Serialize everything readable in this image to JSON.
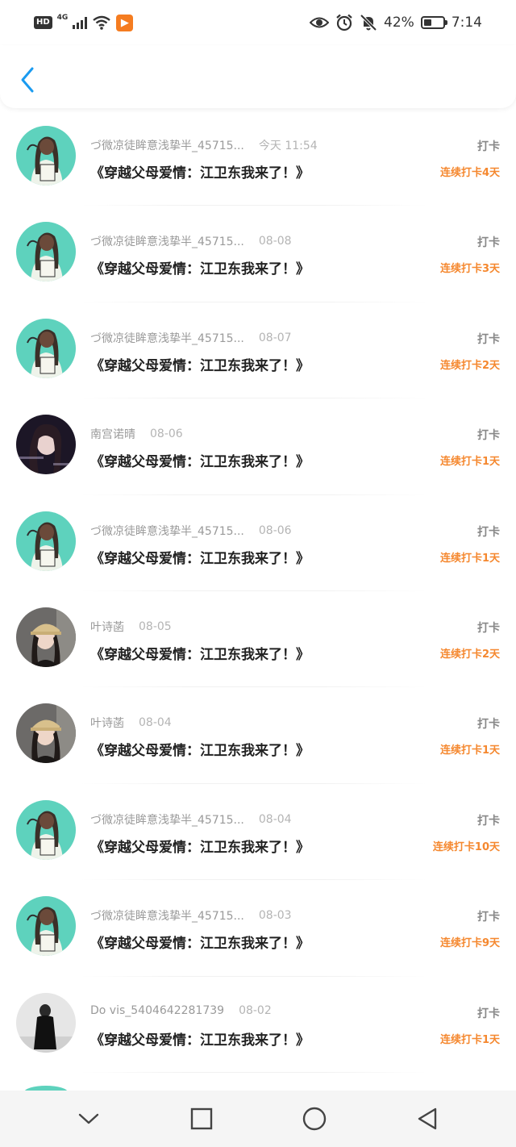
{
  "status_bar": {
    "hd": "HD",
    "network": "4G",
    "battery_pct": "42%",
    "battery_level": 0.42,
    "time": "7:14",
    "icons": [
      "eye-icon",
      "alarm-icon",
      "mute-bell-icon"
    ]
  },
  "header": {
    "back_icon": "chevron-left-icon"
  },
  "colors": {
    "accent": "#f5882f",
    "back": "#1a9bf0",
    "avatar_teal": "#5ed2bd"
  },
  "records": [
    {
      "avatar": "anime",
      "name": "づ微凉徒眸意浅挚半_45715...",
      "date": "今天 11:54",
      "title": "《穿越父母爱情：江卫东我来了！》",
      "tag": "打卡",
      "streak": "连续打卡4天"
    },
    {
      "avatar": "anime",
      "name": "づ微凉徒眸意浅挚半_45715...",
      "date": "08-08",
      "title": "《穿越父母爱情：江卫东我来了！》",
      "tag": "打卡",
      "streak": "连续打卡3天"
    },
    {
      "avatar": "anime",
      "name": "づ微凉徒眸意浅挚半_45715...",
      "date": "08-07",
      "title": "《穿越父母爱情：江卫东我来了！》",
      "tag": "打卡",
      "streak": "连续打卡2天"
    },
    {
      "avatar": "photo-dark",
      "name": "南宫诺晴",
      "date": "08-06",
      "title": "《穿越父母爱情：江卫东我来了！》",
      "tag": "打卡",
      "streak": "连续打卡1天"
    },
    {
      "avatar": "anime",
      "name": "づ微凉徒眸意浅挚半_45715...",
      "date": "08-06",
      "title": "《穿越父母爱情：江卫东我来了！》",
      "tag": "打卡",
      "streak": "连续打卡1天"
    },
    {
      "avatar": "photo-cap",
      "name": "叶诗菡",
      "date": "08-05",
      "title": "《穿越父母爱情：江卫东我来了！》",
      "tag": "打卡",
      "streak": "连续打卡2天"
    },
    {
      "avatar": "photo-cap",
      "name": "叶诗菡",
      "date": "08-04",
      "title": "《穿越父母爱情：江卫东我来了！》",
      "tag": "打卡",
      "streak": "连续打卡1天"
    },
    {
      "avatar": "anime",
      "name": "づ微凉徒眸意浅挚半_45715...",
      "date": "08-04",
      "title": "《穿越父母爱情：江卫东我来了！》",
      "tag": "打卡",
      "streak": "连续打卡10天"
    },
    {
      "avatar": "anime",
      "name": "づ微凉徒眸意浅挚半_45715...",
      "date": "08-03",
      "title": "《穿越父母爱情：江卫东我来了！》",
      "tag": "打卡",
      "streak": "连续打卡9天"
    },
    {
      "avatar": "photo-bw",
      "name": "Do vis_5404642281739",
      "date": "08-02",
      "title": "《穿越父母爱情：江卫东我来了！》",
      "tag": "打卡",
      "streak": "连续打卡1天"
    }
  ],
  "nav_bar": {
    "icons": [
      "collapse-icon",
      "recents-icon",
      "home-icon",
      "back-icon"
    ]
  }
}
